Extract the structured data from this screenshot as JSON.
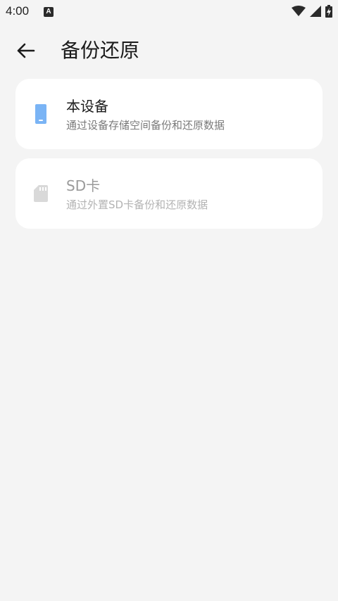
{
  "status_bar": {
    "time": "4:00",
    "notification_letter": "A"
  },
  "app_bar": {
    "title": "备份还原"
  },
  "options": [
    {
      "title": "本设备",
      "description": "通过设备存储空间备份和还原数据",
      "icon": "phone-icon",
      "icon_color": "#7ab4f5",
      "enabled": true
    },
    {
      "title": "SD卡",
      "description": "通过外置SD卡备份和还原数据",
      "icon": "sd-card-icon",
      "icon_color": "#d9d9d9",
      "enabled": false
    }
  ]
}
